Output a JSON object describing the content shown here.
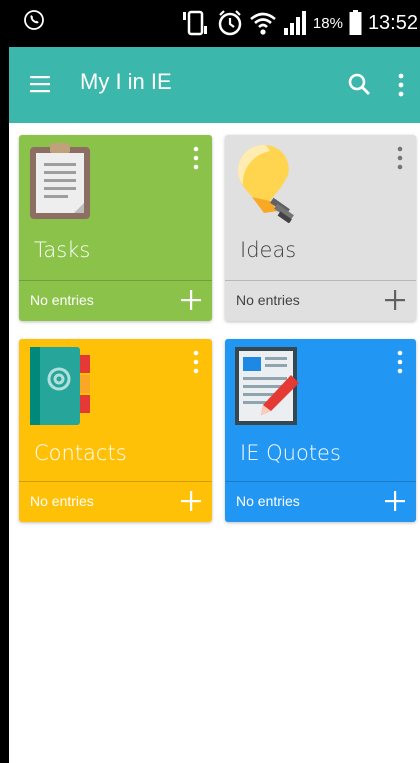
{
  "statusbar": {
    "battery_percent": "18%",
    "time": "13:52"
  },
  "appbar": {
    "title": "My I in IE"
  },
  "cards": [
    {
      "label": "Tasks",
      "footer": "No entries",
      "color": "#8bc34a",
      "icon": "clipboard-icon"
    },
    {
      "label": "Ideas",
      "footer": "No entries",
      "color": "#e0e0e0",
      "icon": "lightbulb-icon"
    },
    {
      "label": "Contacts",
      "footer": "No entries",
      "color": "#ffc107",
      "icon": "address-book-icon"
    },
    {
      "label": "IE Quotes",
      "footer": "No entries",
      "color": "#2196f3",
      "icon": "document-pen-icon"
    }
  ],
  "colors": {
    "appbar": "#3bb7ab",
    "statusbar": "#000000"
  }
}
